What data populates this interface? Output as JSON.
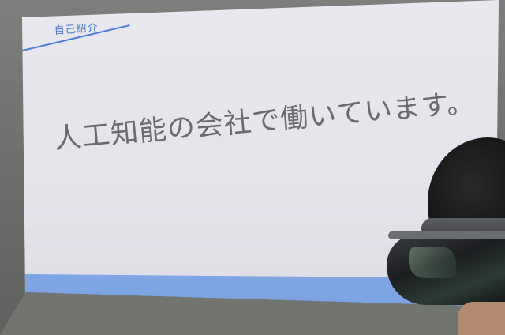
{
  "slide": {
    "header": "自己紹介",
    "body": "人工知能の会社で働いています。"
  },
  "colors": {
    "accent_blue": "#4f82d6",
    "footer_blue": "#8fb3ea",
    "slide_background": "#e7e6ec",
    "body_text": "#6a6b6d"
  },
  "scene": {
    "subject": "person wearing mixed-reality headset-icon"
  }
}
